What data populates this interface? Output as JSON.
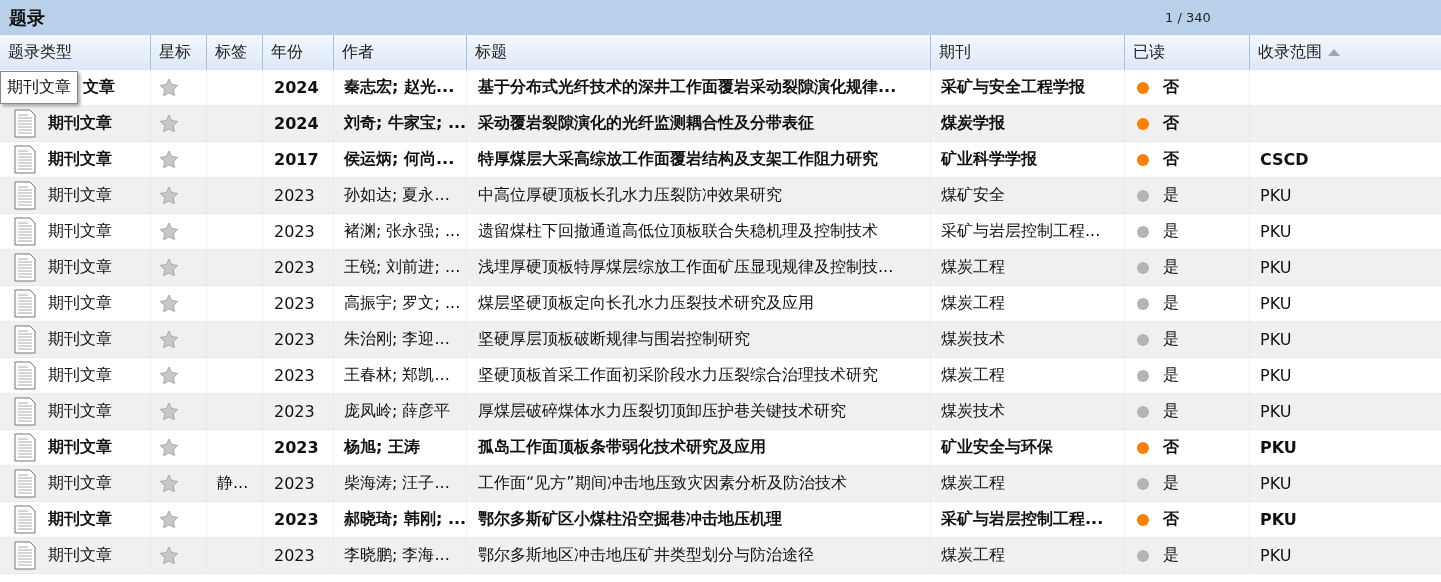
{
  "panel": {
    "title": "题录",
    "counter": "1 / 340"
  },
  "columns": [
    {
      "label": "题录类型",
      "sorted": false
    },
    {
      "label": "星标",
      "sorted": false
    },
    {
      "label": "标签",
      "sorted": false
    },
    {
      "label": "年份",
      "sorted": false
    },
    {
      "label": "作者",
      "sorted": false
    },
    {
      "label": "标题",
      "sorted": false
    },
    {
      "label": "期刊",
      "sorted": false
    },
    {
      "label": "已读",
      "sorted": false
    },
    {
      "label": "收录范围",
      "sorted": true
    }
  ],
  "rows": [
    {
      "tooltip": "期刊文章",
      "type": "文章",
      "starred": false,
      "year": "2024",
      "authors": "秦志宏; 赵光...",
      "title": "基于分布式光纤技术的深井工作面覆岩采动裂隙演化规律...",
      "journal": "采矿与安全工程学报",
      "read": false,
      "read_label": "否"
    },
    {
      "type": "期刊文章",
      "starred": false,
      "year": "2024",
      "authors": "刘奇; 牛家宝; ...",
      "title": "采动覆岩裂隙演化的光纤监测耦合性及分带表征",
      "journal": "煤炭学报",
      "read": false,
      "read_label": "否"
    },
    {
      "type": "期刊文章",
      "starred": false,
      "year": "2017",
      "authors": "侯运炳; 何尚...",
      "title": "特厚煤层大采高综放工作面覆岩结构及支架工作阻力研究",
      "journal": "矿业科学学报",
      "read": false,
      "read_label": "否",
      "scope": "CSCD"
    },
    {
      "type": "期刊文章",
      "starred": false,
      "year": "2023",
      "authors": "孙如达; 夏永...",
      "title": "中高位厚硬顶板长孔水力压裂防冲效果研究",
      "journal": "煤矿安全",
      "read": true,
      "read_label": "是",
      "scope": "PKU"
    },
    {
      "type": "期刊文章",
      "starred": false,
      "year": "2023",
      "authors": "褚渊; 张永强; ...",
      "title": "遗留煤柱下回撤通道高低位顶板联合失稳机理及控制技术",
      "journal": "采矿与岩层控制工程...",
      "read": true,
      "read_label": "是",
      "scope": "PKU"
    },
    {
      "type": "期刊文章",
      "starred": false,
      "year": "2023",
      "authors": "王锐; 刘前进; ...",
      "title": "浅埋厚硬顶板特厚煤层综放工作面矿压显现规律及控制技...",
      "journal": "煤炭工程",
      "read": true,
      "read_label": "是",
      "scope": "PKU"
    },
    {
      "type": "期刊文章",
      "starred": false,
      "year": "2023",
      "authors": "高振宇; 罗文; ...",
      "title": "煤层坚硬顶板定向长孔水力压裂技术研究及应用",
      "journal": "煤炭工程",
      "read": true,
      "read_label": "是",
      "scope": "PKU"
    },
    {
      "type": "期刊文章",
      "starred": false,
      "year": "2023",
      "authors": "朱治刚; 李迎...",
      "title": "坚硬厚层顶板破断规律与围岩控制研究",
      "journal": "煤炭技术",
      "read": true,
      "read_label": "是",
      "scope": "PKU"
    },
    {
      "type": "期刊文章",
      "starred": false,
      "year": "2023",
      "authors": "王春林; 郑凯...",
      "title": "坚硬顶板首采工作面初采阶段水力压裂综合治理技术研究",
      "journal": "煤炭工程",
      "read": true,
      "read_label": "是",
      "scope": "PKU"
    },
    {
      "type": "期刊文章",
      "starred": false,
      "year": "2023",
      "authors": "庞凤岭; 薛彦平",
      "title": "厚煤层破碎煤体水力压裂切顶卸压护巷关键技术研究",
      "journal": "煤炭技术",
      "read": true,
      "read_label": "是",
      "scope": "PKU"
    },
    {
      "type": "期刊文章",
      "starred": false,
      "year": "2023",
      "authors": "杨旭; 王涛",
      "title": "孤岛工作面顶板条带弱化技术研究及应用",
      "journal": "矿业安全与环保",
      "read": false,
      "read_label": "否",
      "scope": "PKU"
    },
    {
      "type": "期刊文章",
      "starred": false,
      "tag": "静...",
      "year": "2023",
      "authors": "柴海涛; 汪子...",
      "title": "工作面“见方”期间冲击地压致灾因素分析及防治技术",
      "journal": "煤炭工程",
      "read": true,
      "read_label": "是",
      "scope": "PKU"
    },
    {
      "type": "期刊文章",
      "starred": false,
      "year": "2023",
      "authors": "郝晓琦; 韩刚; ...",
      "title": "鄂尔多斯矿区小煤柱沿空掘巷冲击地压机理",
      "journal": "采矿与岩层控制工程...",
      "read": false,
      "read_label": "否",
      "scope": "PKU"
    },
    {
      "type": "期刊文章",
      "starred": false,
      "year": "2023",
      "authors": "李晓鹏; 李海...",
      "title": "鄂尔多斯地区冲击地压矿井类型划分与防治途径",
      "journal": "煤炭工程",
      "read": true,
      "read_label": "是",
      "scope": "PKU"
    }
  ]
}
